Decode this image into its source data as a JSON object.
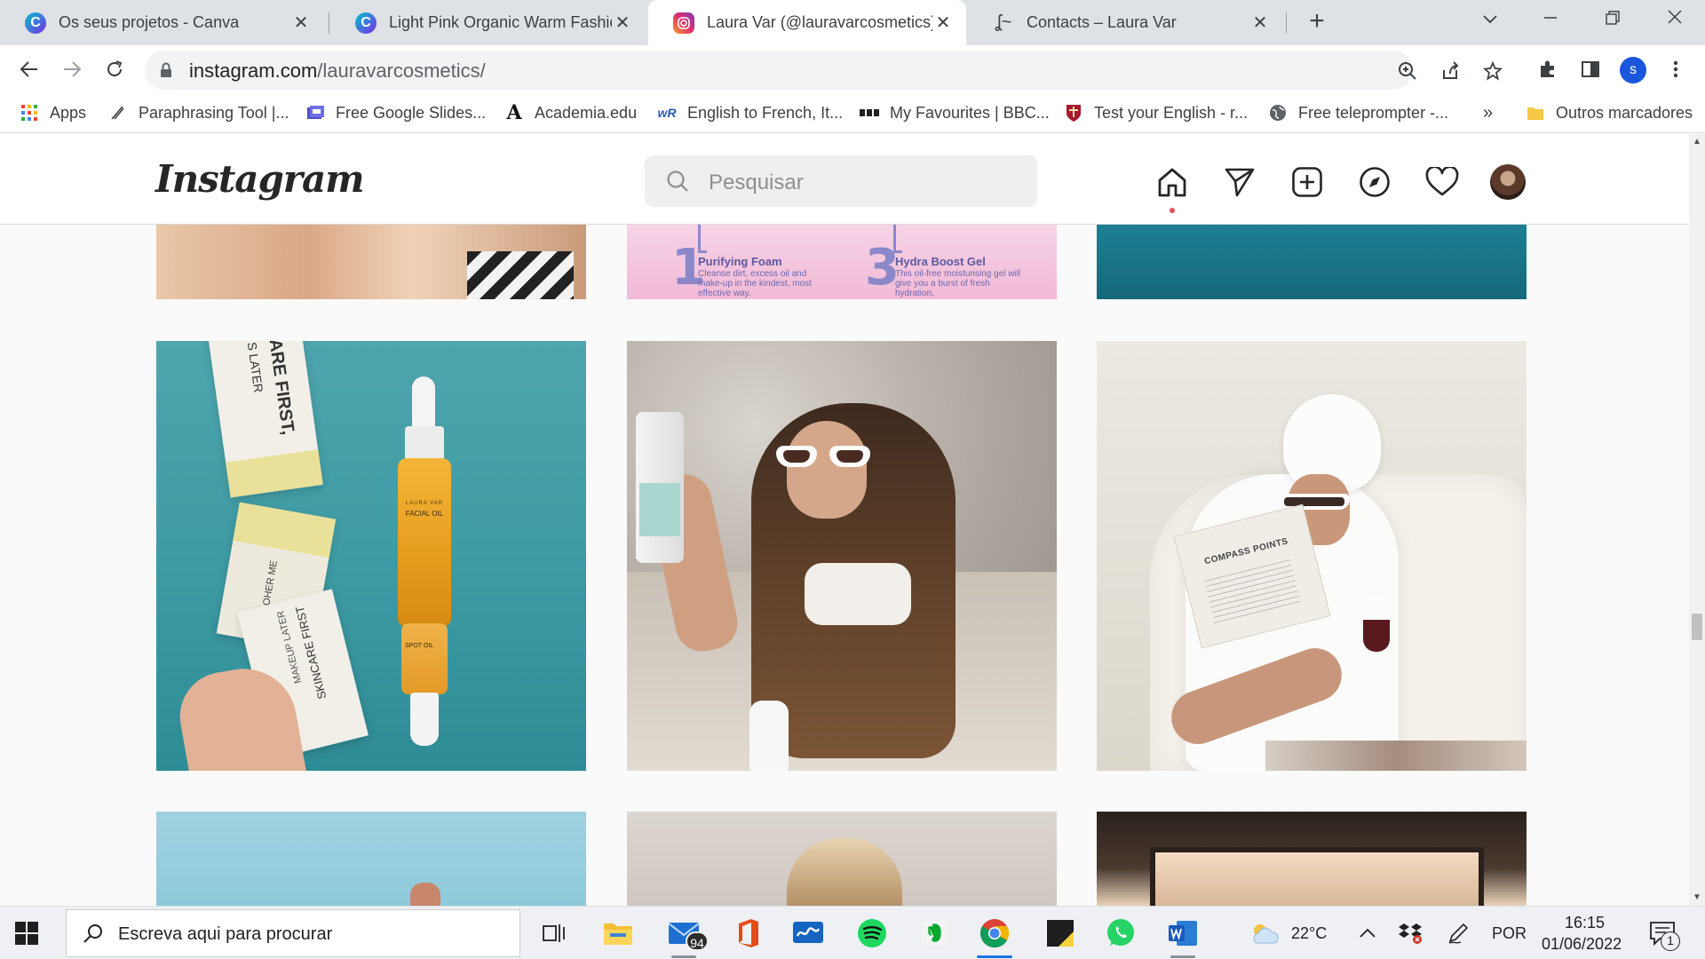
{
  "browser": {
    "tabs": [
      {
        "title": "Os seus projetos - Canva",
        "icon": "canva-icon",
        "active": false
      },
      {
        "title": "Light Pink Organic Warm Fashion",
        "icon": "canva-icon",
        "active": false
      },
      {
        "title": "Laura Var (@lauravarcosmetics) •",
        "icon": "instagram-icon",
        "active": true
      },
      {
        "title": "Contacts – Laura Var",
        "icon": "signature-icon",
        "active": false
      }
    ],
    "url_host": "instagram.com",
    "url_path": "/lauravarcosmetics/",
    "profile_initial": "s",
    "bookmarks": [
      {
        "label": "Apps",
        "icon": "apps-grid-icon"
      },
      {
        "label": "Paraphrasing Tool |...",
        "icon": "quill-icon"
      },
      {
        "label": "Free Google Slides...",
        "icon": "slides-icon"
      },
      {
        "label": "Academia.edu",
        "icon": "academia-icon"
      },
      {
        "label": "English to French, It...",
        "icon": "wordreference-icon"
      },
      {
        "label": "My Favourites | BBC...",
        "icon": "bbc-icon"
      },
      {
        "label": "Test your English - r...",
        "icon": "cambridge-icon"
      },
      {
        "label": "Free teleprompter -...",
        "icon": "globe-icon"
      }
    ],
    "overflow_label": "»",
    "other_bookmarks": "Outros marcadores"
  },
  "instagram": {
    "logo": "Instagram",
    "search_placeholder": "Pesquisar",
    "nav_icons": [
      "home-icon",
      "direct-icon",
      "new-post-icon",
      "explore-icon",
      "activity-icon",
      "profile-avatar"
    ],
    "posts": {
      "p01": {
        "steps": [
          {
            "number": "1",
            "title": "Purifying Foam",
            "text": "Cleanse dirt, excess oil and make-up in the kindest, most effective way."
          },
          {
            "number": "3",
            "title": "Hydra Boost Gel",
            "text": "This oil-free moisturising gel will give you a burst of fresh hydration."
          }
        ]
      },
      "p10": {
        "box_text_top": "ARE FIRST,",
        "box_text_top2": "S LATER",
        "box_text_mid": "OHER ME",
        "box_text_bottom": "SKINCARE FIRST",
        "box_text_bottom2": "MAKEUP LATER",
        "bottle_brand": "LAURA VAR",
        "bottle_label": "FACIAL OIL",
        "bottle_label2": "SPOT OIL"
      },
      "p12": {
        "magazine_title": "COMPASS POINTS"
      }
    }
  },
  "taskbar": {
    "search_placeholder": "Escreva aqui para procurar",
    "apps": [
      "task-view-icon",
      "file-explorer-icon",
      "mail-icon",
      "office-icon",
      "whiteboard-icon",
      "spotify-icon",
      "evernote-icon",
      "chrome-icon",
      "sticky-notes-icon",
      "whatsapp-icon",
      "word-icon"
    ],
    "mail_badge": "94",
    "weather": "22°C",
    "language": "POR",
    "time": "16:15",
    "date": "01/06/2022",
    "notifications": "1"
  }
}
